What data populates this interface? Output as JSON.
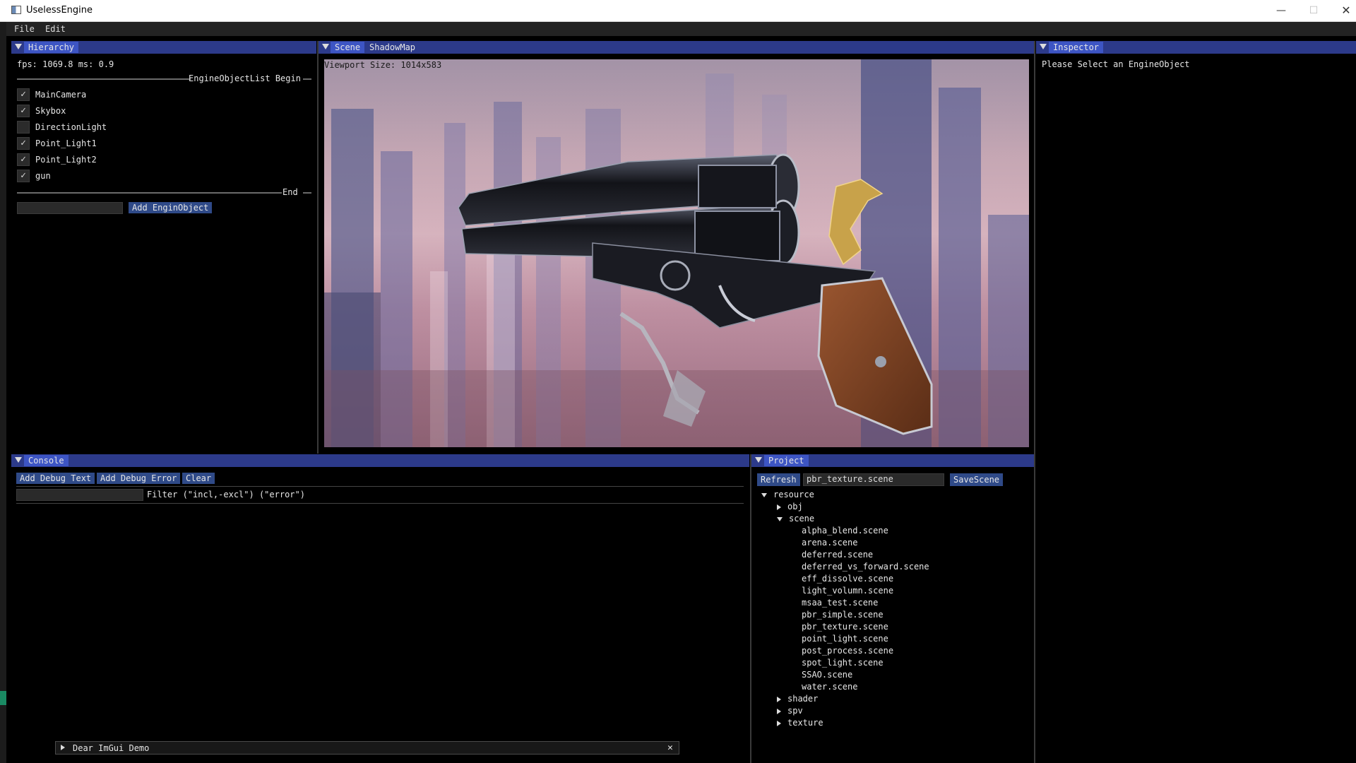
{
  "window": {
    "title": "UselessEngine",
    "minimize": "—",
    "maximize": "☐",
    "close": "✕"
  },
  "menu": {
    "items": [
      "File",
      "Edit"
    ]
  },
  "hierarchy": {
    "tab": "Hierarchy",
    "fps_text": "fps: 1069.8 ms: 0.9",
    "list_begin": "EngineObjectList Begin",
    "list_end": "End",
    "objects": [
      {
        "name": "MainCamera",
        "checked": true
      },
      {
        "name": "Skybox",
        "checked": true
      },
      {
        "name": "DirectionLight",
        "checked": false
      },
      {
        "name": "Point_Light1",
        "checked": true
      },
      {
        "name": "Point_Light2",
        "checked": true
      },
      {
        "name": "gun",
        "checked": true
      }
    ],
    "name_input_value": "",
    "add_button": "Add EnginObject"
  },
  "scene": {
    "tabs": [
      "Scene",
      "ShadowMap"
    ],
    "viewport_label": "Viewport Size: 1014x583"
  },
  "inspector": {
    "tab": "Inspector",
    "message": "Please Select an EngineObject"
  },
  "console": {
    "tab": "Console",
    "buttons": [
      "Add Debug Text",
      "Add Debug Error",
      "Clear"
    ],
    "filter_value": "",
    "filter_label": "Filter (\"incl,-excl\") (\"error\")"
  },
  "project": {
    "tab": "Project",
    "refresh": "Refresh",
    "scene_name_value": "pbr_texture.scene",
    "save": "SaveScene",
    "root": "resource",
    "folders_before": [
      "obj"
    ],
    "open_folder": "scene",
    "scene_files": [
      "alpha_blend.scene",
      "arena.scene",
      "deferred.scene",
      "deferred_vs_forward.scene",
      "eff_dissolve.scene",
      "light_volumn.scene",
      "msaa_test.scene",
      "pbr_simple.scene",
      "pbr_texture.scene",
      "point_light.scene",
      "post_process.scene",
      "spot_light.scene",
      "SSAO.scene",
      "water.scene"
    ],
    "folders_after": [
      "shader",
      "spv",
      "texture"
    ]
  },
  "demo_window": {
    "title": "Dear ImGui Demo",
    "close": "✕"
  }
}
